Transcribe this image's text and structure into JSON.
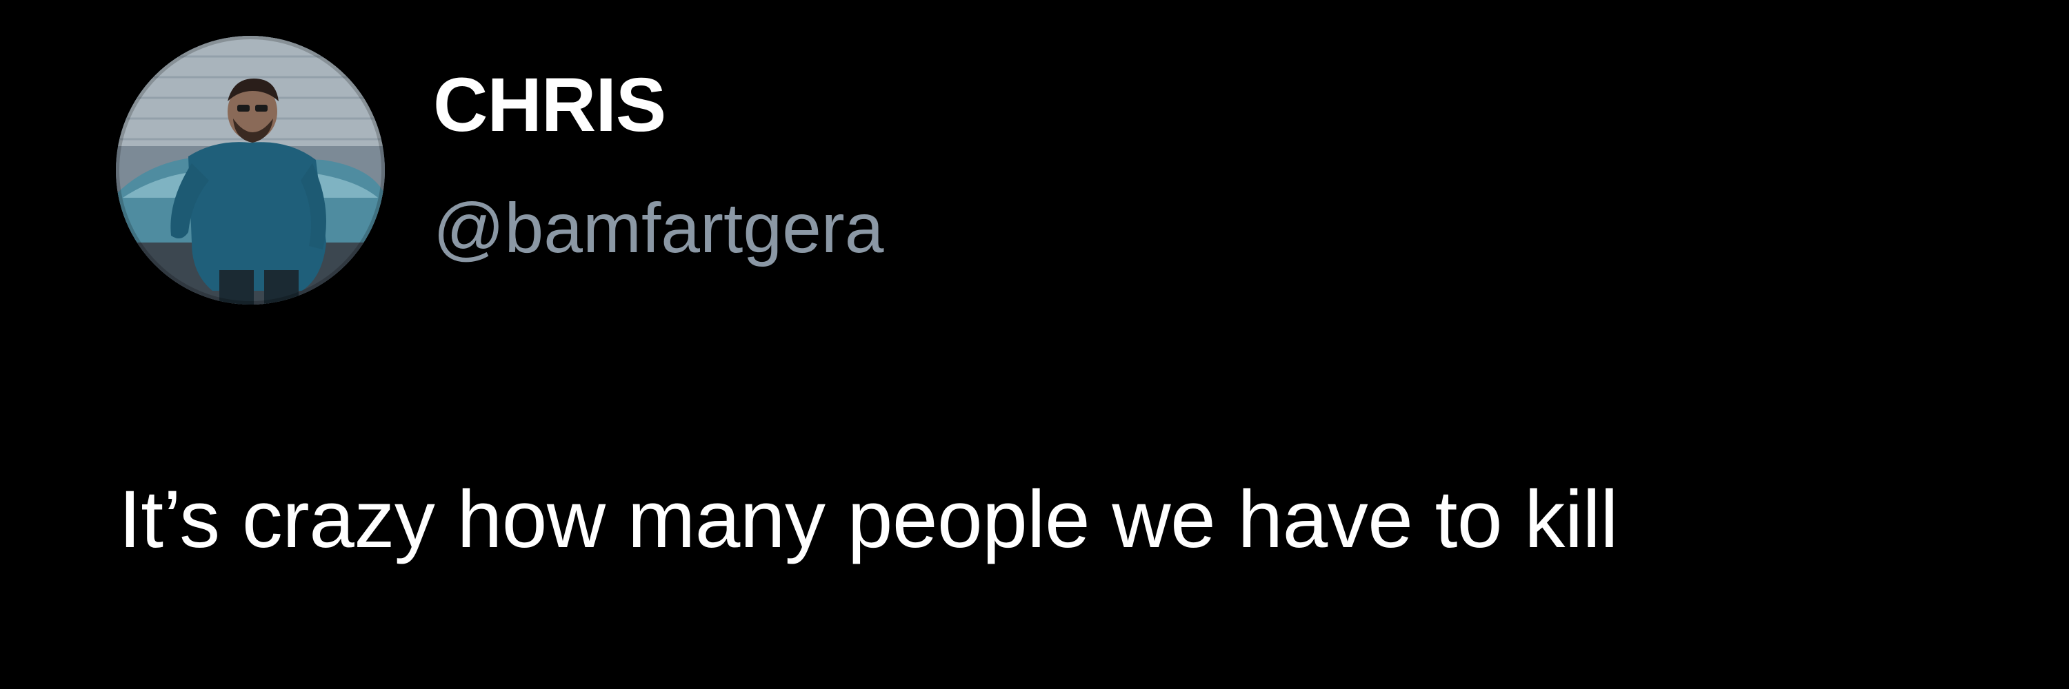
{
  "tweet": {
    "author": {
      "display_name": "CHRIS",
      "handle": "@bamfartgera",
      "avatar_icon": "user-photo-avatar"
    },
    "text": "It’s crazy how many people we have to kill"
  },
  "colors": {
    "background": "#000000",
    "display_name": "#ffffff",
    "handle": "#8b98a5",
    "text": "#ffffff"
  }
}
